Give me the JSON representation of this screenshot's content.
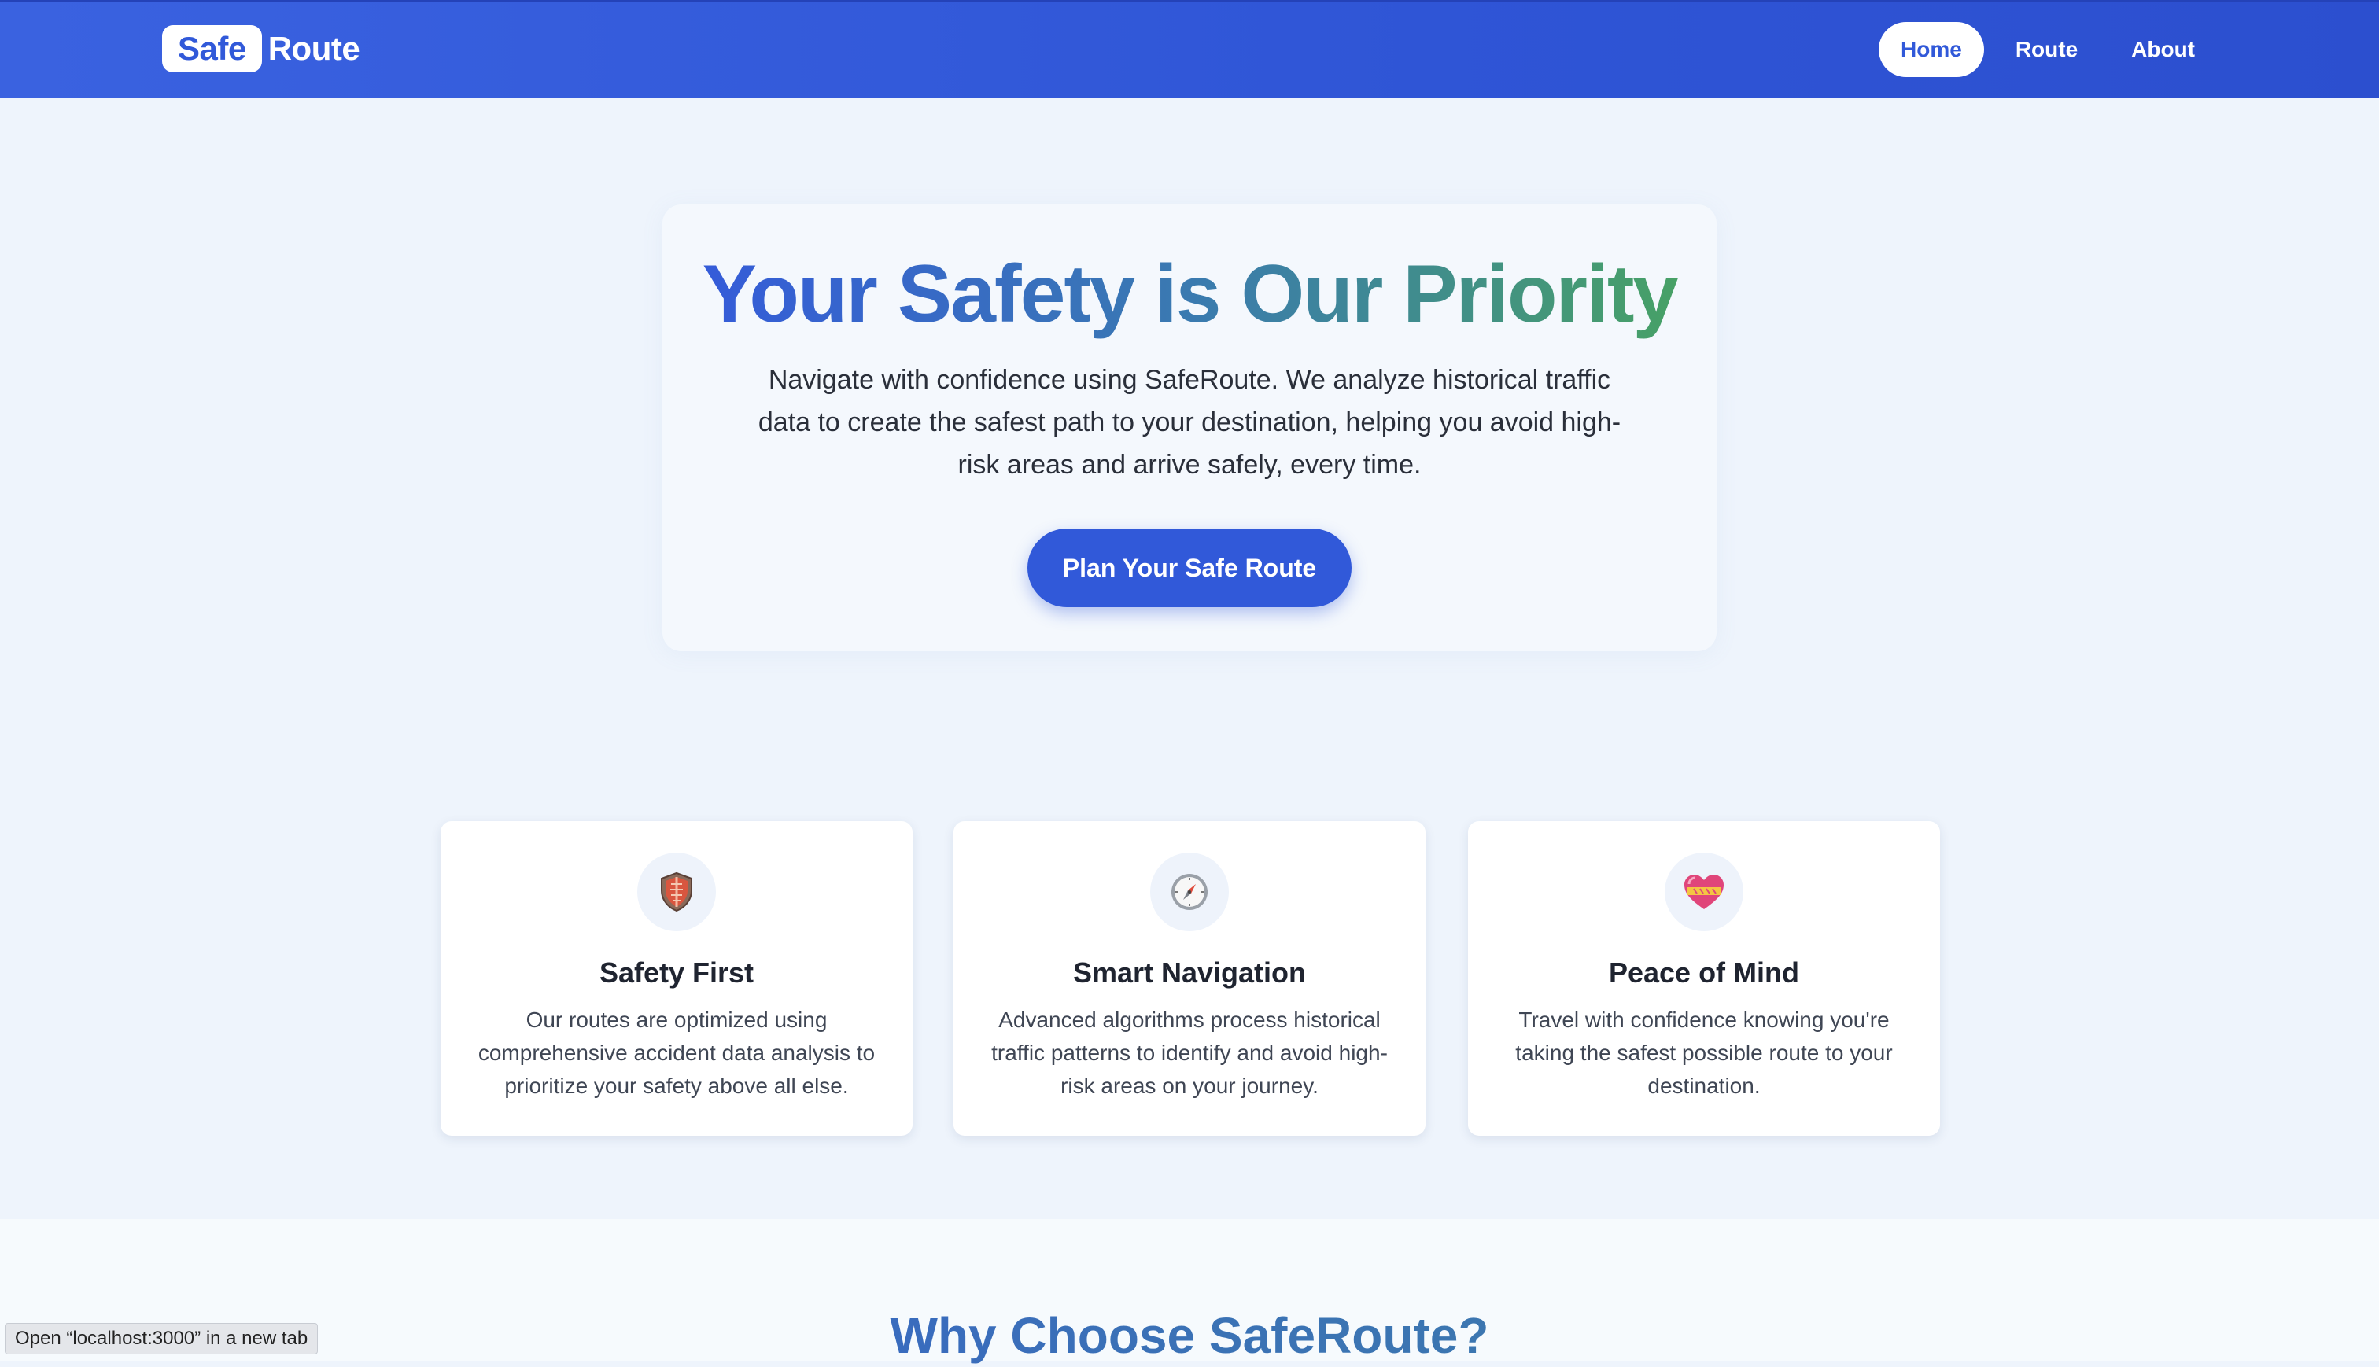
{
  "nav": {
    "logo_safe": "Safe",
    "logo_route": "Route",
    "links": [
      {
        "label": "Home",
        "active": true
      },
      {
        "label": "Route",
        "active": false
      },
      {
        "label": "About",
        "active": false
      }
    ]
  },
  "hero": {
    "title": "Your Safety is Our Priority",
    "description": "Navigate with confidence using SafeRoute. We analyze historical traffic data to create the safest path to your destination, helping you avoid high-risk areas and arrive safely, every time.",
    "cta_label": "Plan Your Safe Route"
  },
  "features": [
    {
      "icon": "shield-icon",
      "title": "Safety First",
      "description": "Our routes are optimized using comprehensive accident data analysis to prioritize your safety above all else."
    },
    {
      "icon": "compass-icon",
      "title": "Smart Navigation",
      "description": "Advanced algorithms process historical traffic patterns to identify and avoid high-risk areas on your journey."
    },
    {
      "icon": "heart-icon",
      "title": "Peace of Mind",
      "description": "Travel with confidence knowing you're taking the safest possible route to your destination."
    }
  ],
  "why": {
    "title": "Why Choose SafeRoute?"
  },
  "status_bar": {
    "text": "Open “localhost:3000” in a new tab"
  },
  "colors": {
    "brand_blue": "#3159d9",
    "accent_green": "#48a460",
    "page_bg": "#eef4fc"
  }
}
